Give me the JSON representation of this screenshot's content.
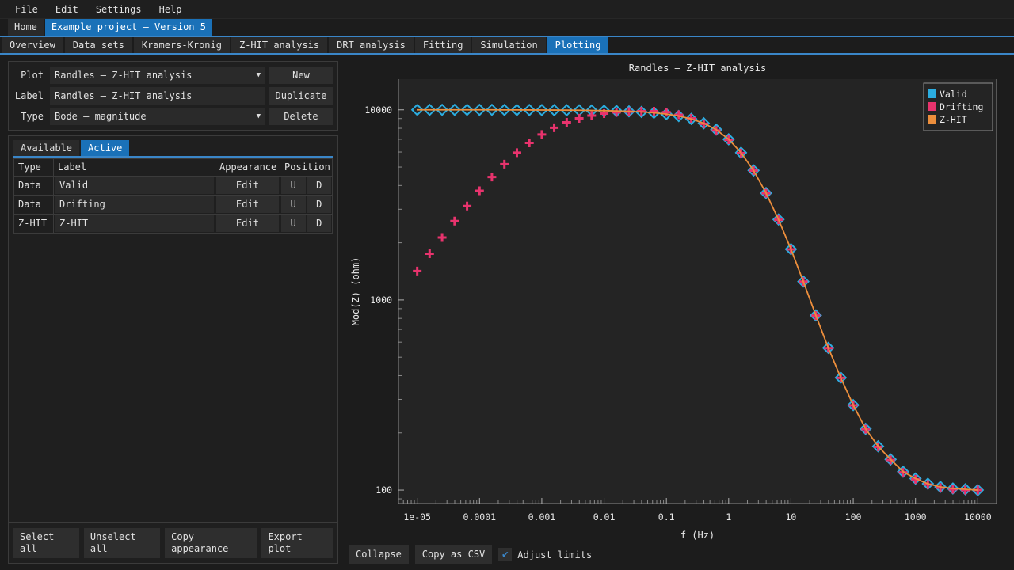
{
  "menubar": {
    "items": [
      {
        "label": "File"
      },
      {
        "label": "Edit"
      },
      {
        "label": "Settings"
      },
      {
        "label": "Help"
      }
    ]
  },
  "project_tabs": [
    {
      "label": "Home",
      "active": false
    },
    {
      "label": "Example project – Version 5",
      "active": true
    }
  ],
  "main_tabs": [
    {
      "label": "Overview",
      "active": false
    },
    {
      "label": "Data sets",
      "active": false
    },
    {
      "label": "Kramers-Kronig",
      "active": false
    },
    {
      "label": "Z-HIT analysis",
      "active": false
    },
    {
      "label": "DRT analysis",
      "active": false
    },
    {
      "label": "Fitting",
      "active": false
    },
    {
      "label": "Simulation",
      "active": false
    },
    {
      "label": "Plotting",
      "active": true
    }
  ],
  "form": {
    "plot_label": "Plot",
    "plot_value": "Randles – Z-HIT analysis",
    "label_label": "Label",
    "label_value": "Randles – Z-HIT analysis",
    "type_label": "Type",
    "type_value": "Bode – magnitude",
    "new_button": "New",
    "duplicate_button": "Duplicate",
    "delete_button": "Delete",
    "caret": "▼"
  },
  "subtabs": [
    {
      "label": "Available",
      "active": false
    },
    {
      "label": "Active",
      "active": true
    }
  ],
  "table": {
    "headers": [
      "Type",
      "Label",
      "Appearance",
      "Position"
    ],
    "rows": [
      {
        "type": "Data",
        "label": "Valid",
        "appearance": "Edit",
        "up": "U",
        "down": "D"
      },
      {
        "type": "Data",
        "label": "Drifting",
        "appearance": "Edit",
        "up": "U",
        "down": "D"
      },
      {
        "type": "Z-HIT",
        "label": "Z-HIT",
        "appearance": "Edit",
        "up": "U",
        "down": "D"
      }
    ]
  },
  "left_bottom_buttons": [
    {
      "label": "Select all"
    },
    {
      "label": "Unselect all"
    },
    {
      "label": "Copy appearance"
    },
    {
      "label": "Export plot"
    }
  ],
  "plot_bottom": {
    "collapse_button": "Collapse",
    "copy_csv_button": "Copy as CSV",
    "adjust_limits_label": "Adjust limits",
    "adjust_limits_checked": true,
    "check_glyph": "✔"
  },
  "colors": {
    "accent": "#1a71b8",
    "valid": "#2badE0",
    "drifting": "#e8336d",
    "zhit": "#ec8e3c",
    "panel_bg": "#1f1f1f",
    "window_bg": "#1c1c1c",
    "plot_bg": "#242424"
  },
  "chart_data": {
    "type": "line",
    "title": "Randles – Z-HIT analysis",
    "xlabel": "f (Hz)",
    "ylabel": "Mod(Z) (ohm)",
    "xscale": "log",
    "yscale": "log",
    "xlim": [
      5e-06,
      20000
    ],
    "ylim": [
      85,
      14500
    ],
    "xticks": [
      "1e-05",
      "0.0001",
      "0.001",
      "0.01",
      "0.1",
      "1",
      "10",
      "100",
      "1000",
      "10000"
    ],
    "xtick_values": [
      1e-05,
      0.0001,
      0.001,
      0.01,
      0.1,
      1,
      10,
      100,
      1000,
      10000
    ],
    "yticks": [
      "10000",
      "1000",
      "100"
    ],
    "ytick_values": [
      10000,
      1000,
      100
    ],
    "grid": false,
    "legend_position": "upper right",
    "series": [
      {
        "name": "Valid",
        "color": "#2bade0",
        "marker": "diamond",
        "x": [
          1e-05,
          1.58e-05,
          2.51e-05,
          3.98e-05,
          6.31e-05,
          0.0001,
          0.000158,
          0.000251,
          0.000398,
          0.000631,
          0.001,
          0.00158,
          0.00251,
          0.00398,
          0.00631,
          0.01,
          0.0158,
          0.0251,
          0.0398,
          0.0631,
          0.1,
          0.158,
          0.251,
          0.398,
          0.631,
          1.0,
          1.58,
          2.51,
          3.98,
          6.31,
          10.0,
          15.8,
          25.1,
          39.8,
          63.1,
          100.0,
          158.0,
          251.0,
          398.0,
          631.0,
          1000.0,
          1580.0,
          2510.0,
          3980.0,
          6310.0,
          10000.0
        ],
        "y": [
          10000,
          10000,
          10000,
          10000,
          10000,
          10000,
          10000,
          9990,
          9985,
          9980,
          9975,
          9970,
          9960,
          9950,
          9930,
          9900,
          9870,
          9820,
          9750,
          9650,
          9500,
          9280,
          8960,
          8500,
          7870,
          7000,
          5950,
          4800,
          3650,
          2650,
          1850,
          1250,
          830,
          560,
          390,
          280,
          210,
          170,
          145,
          125,
          115,
          108,
          104,
          102,
          101,
          100
        ]
      },
      {
        "name": "Drifting",
        "color": "#e8336d",
        "marker": "plus",
        "x": [
          1e-05,
          1.58e-05,
          2.51e-05,
          3.98e-05,
          6.31e-05,
          0.0001,
          0.000158,
          0.000251,
          0.000398,
          0.000631,
          0.001,
          0.00158,
          0.00251,
          0.00398,
          0.00631,
          0.01,
          0.0158,
          0.0251,
          0.0398,
          0.0631,
          0.1,
          0.158,
          0.251,
          0.398,
          0.631,
          1.0,
          1.58,
          2.51,
          3.98,
          6.31,
          10.0,
          15.8,
          25.1,
          39.8,
          63.1,
          100.0,
          158.0,
          251.0,
          398.0,
          631.0,
          1000.0,
          1580.0,
          2510.0,
          3980.0,
          6310.0,
          10000.0
        ],
        "y": [
          1420,
          1750,
          2130,
          2600,
          3120,
          3750,
          4430,
          5180,
          5950,
          6700,
          7420,
          8050,
          8600,
          9020,
          9330,
          9560,
          9700,
          9790,
          9830,
          9830,
          9720,
          9420,
          9020,
          8450,
          7790,
          6960,
          5920,
          4790,
          3640,
          2640,
          1845,
          1248,
          828,
          558,
          389,
          279,
          209,
          169,
          144,
          124,
          114,
          107,
          103,
          101,
          100,
          100
        ]
      },
      {
        "name": "Z-HIT",
        "color": "#ec8e3c",
        "marker": "line",
        "x": [
          1e-05,
          1.58e-05,
          2.51e-05,
          3.98e-05,
          6.31e-05,
          0.0001,
          0.000158,
          0.000251,
          0.000398,
          0.000631,
          0.001,
          0.00158,
          0.00251,
          0.00398,
          0.00631,
          0.01,
          0.0158,
          0.0251,
          0.0398,
          0.0631,
          0.1,
          0.158,
          0.251,
          0.398,
          0.631,
          1.0,
          1.58,
          2.51,
          3.98,
          6.31,
          10.0,
          15.8,
          25.1,
          39.8,
          63.1,
          100.0,
          158.0,
          251.0,
          398.0,
          631.0,
          1000.0,
          1580.0,
          2510.0,
          3980.0,
          6310.0,
          10000.0
        ],
        "y": [
          10000,
          10000,
          10000,
          10000,
          10000,
          10000,
          10000,
          9990,
          9985,
          9980,
          9975,
          9970,
          9960,
          9950,
          9930,
          9900,
          9870,
          9820,
          9750,
          9650,
          9500,
          9280,
          8960,
          8500,
          7870,
          7000,
          5950,
          4800,
          3650,
          2650,
          1850,
          1250,
          830,
          560,
          390,
          280,
          210,
          170,
          145,
          125,
          115,
          108,
          104,
          102,
          101,
          100
        ]
      }
    ],
    "legend": [
      {
        "label": "Valid",
        "color": "#2bade0"
      },
      {
        "label": "Drifting",
        "color": "#e8336d"
      },
      {
        "label": "Z-HIT",
        "color": "#ec8e3c"
      }
    ]
  }
}
